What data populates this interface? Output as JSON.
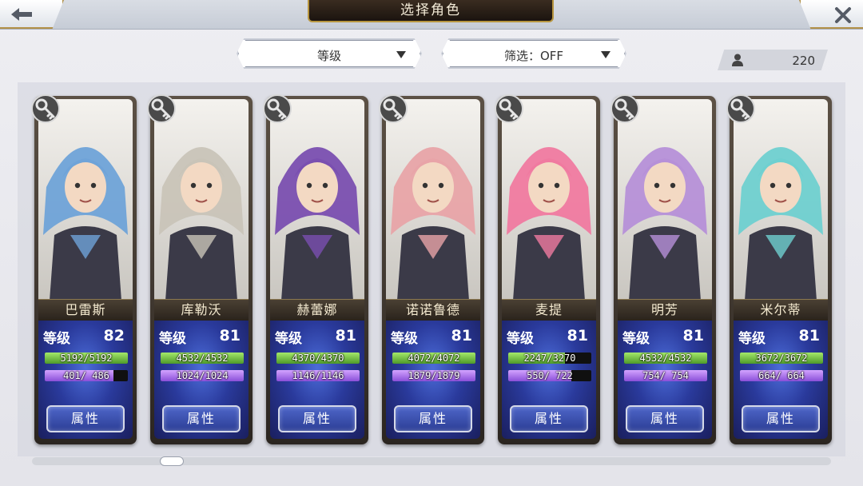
{
  "header": {
    "title": "选择角色"
  },
  "toolbar": {
    "sort_label": "等级",
    "filter_label": "筛选：OFF",
    "character_count": "220"
  },
  "cards": [
    {
      "name": "巴雷斯",
      "level_label": "等级",
      "level": "82",
      "hp_text": "5192/5192",
      "hp_fill": 1.0,
      "mp_text": " 401/ 486",
      "mp_fill": 0.825,
      "attr_label": "属性",
      "palette": "#6fa3d8"
    },
    {
      "name": "库勒沃",
      "level_label": "等级",
      "level": "81",
      "hp_text": "4532/4532",
      "hp_fill": 1.0,
      "mp_text": "1024/1024",
      "mp_fill": 1.0,
      "attr_label": "属性",
      "palette": "#c9c4b8"
    },
    {
      "name": "赫蕾娜",
      "level_label": "等级",
      "level": "81",
      "hp_text": "4370/4370",
      "hp_fill": 1.0,
      "mp_text": "1146/1146",
      "mp_fill": 1.0,
      "attr_label": "属性",
      "palette": "#7a4fb0"
    },
    {
      "name": "诺诺鲁德",
      "level_label": "等级",
      "level": "81",
      "hp_text": "4072/4072",
      "hp_fill": 1.0,
      "mp_text": "1879/1879",
      "mp_fill": 1.0,
      "attr_label": "属性",
      "palette": "#e8a4a8"
    },
    {
      "name": "麦提",
      "level_label": "等级",
      "level": "81",
      "hp_text": "2247/3270",
      "hp_fill": 0.687,
      "mp_text": " 550/ 722",
      "mp_fill": 0.762,
      "attr_label": "属性",
      "palette": "#f07aa0"
    },
    {
      "name": "明芳",
      "level_label": "等级",
      "level": "81",
      "hp_text": "4532/4532",
      "hp_fill": 1.0,
      "mp_text": " 754/ 754",
      "mp_fill": 1.0,
      "attr_label": "属性",
      "palette": "#b690d8"
    },
    {
      "name": "米尔蒂",
      "level_label": "等级",
      "level": "81",
      "hp_text": "3672/3672",
      "hp_fill": 1.0,
      "mp_text": " 664/ 664",
      "mp_fill": 1.0,
      "attr_label": "属性",
      "palette": "#6fd0d0"
    }
  ],
  "icons": {
    "back": "back-arrow-icon",
    "close": "close-icon",
    "dropdown": "chevron-down-icon",
    "count": "person-icon",
    "lock": "key-lock-icon"
  },
  "colors": {
    "hp_bar": "#6cc244",
    "mp_bar": "#a46ee8",
    "stat_panel": "#2a3a9c",
    "frame_gold": "#b8963f"
  }
}
